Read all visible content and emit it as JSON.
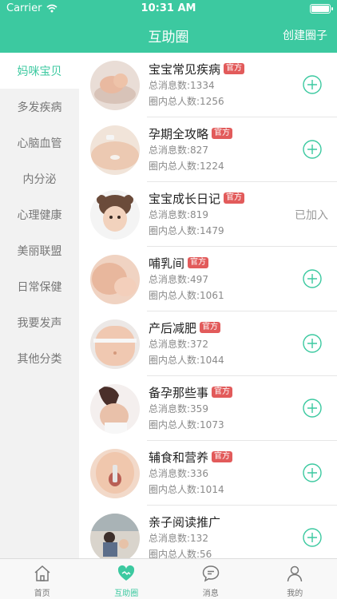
{
  "status_bar": {
    "carrier": "Carrier",
    "time": "10:31 AM"
  },
  "header": {
    "title": "互助圈",
    "action": "创建圈子"
  },
  "sidebar": {
    "items": [
      {
        "label": "妈咪宝贝"
      },
      {
        "label": "多发疾病"
      },
      {
        "label": "心脑血管"
      },
      {
        "label": "内分泌"
      },
      {
        "label": "心理健康"
      },
      {
        "label": "美丽联盟"
      },
      {
        "label": "日常保健"
      },
      {
        "label": "我要发声"
      },
      {
        "label": "其他分类"
      }
    ]
  },
  "circles": [
    {
      "title": "宝宝常见疾病",
      "badge": "官方",
      "messages": "总消息数:1334",
      "members": "圈内总人数:1256",
      "joined_label": ""
    },
    {
      "title": "孕期全攻略",
      "badge": "官方",
      "messages": "总消息数:827",
      "members": "圈内总人数:1224",
      "joined_label": ""
    },
    {
      "title": "宝宝成长日记",
      "badge": "官方",
      "messages": "总消息数:819",
      "members": "圈内总人数:1479",
      "joined_label": "已加入"
    },
    {
      "title": "哺乳间",
      "badge": "官方",
      "messages": "总消息数:497",
      "members": "圈内总人数:1061",
      "joined_label": ""
    },
    {
      "title": "产后减肥",
      "badge": "官方",
      "messages": "总消息数:372",
      "members": "圈内总人数:1044",
      "joined_label": ""
    },
    {
      "title": "备孕那些事",
      "badge": "官方",
      "messages": "总消息数:359",
      "members": "圈内总人数:1073",
      "joined_label": ""
    },
    {
      "title": "辅食和营养",
      "badge": "官方",
      "messages": "总消息数:336",
      "members": "圈内总人数:1014",
      "joined_label": ""
    },
    {
      "title": "亲子阅读推广",
      "badge": "",
      "messages": "总消息数:132",
      "members": "圈内总人数:56",
      "joined_label": ""
    }
  ],
  "tabbar": {
    "items": [
      {
        "label": "首页",
        "icon": "home-icon"
      },
      {
        "label": "互助圈",
        "icon": "handshake-heart-icon"
      },
      {
        "label": "消息",
        "icon": "chat-bubble-icon"
      },
      {
        "label": "我的",
        "icon": "person-icon"
      }
    ]
  },
  "colors": {
    "accent": "#3cc9a0",
    "badge": "#e25b5b"
  }
}
